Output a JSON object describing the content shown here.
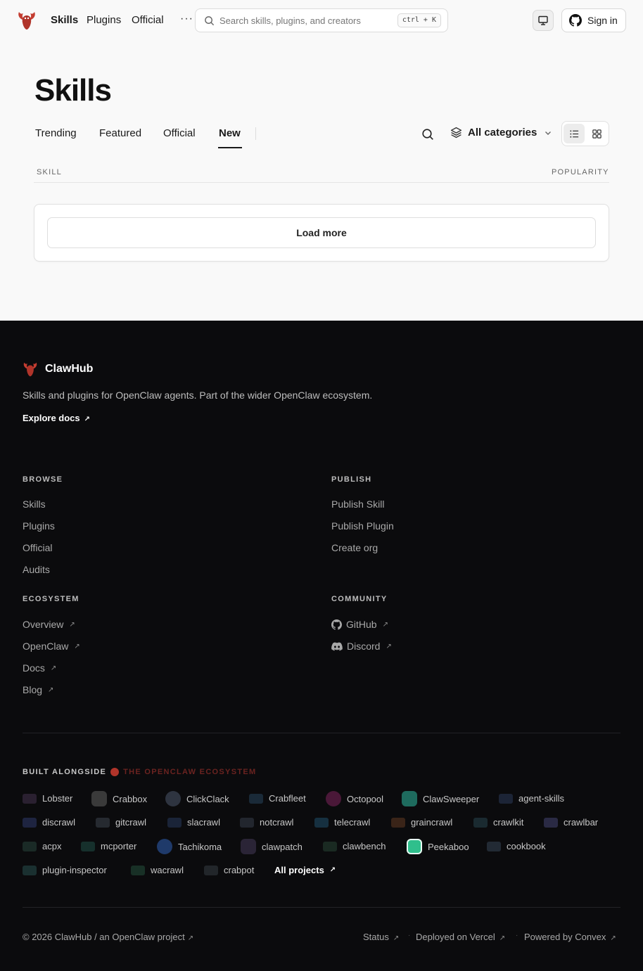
{
  "header": {
    "nav": [
      {
        "label": "Skills"
      },
      {
        "label": "Plugins"
      },
      {
        "label": "Official"
      }
    ],
    "more_label": "···",
    "search_placeholder": "Search skills, plugins, and creators",
    "shortcut": "ctrl + K",
    "sign_in_label": "Sign in"
  },
  "main": {
    "title": "Skills",
    "tabs": [
      {
        "label": "Trending"
      },
      {
        "label": "Featured"
      },
      {
        "label": "Official"
      },
      {
        "label": "New"
      }
    ],
    "active_tab": "New",
    "categories_label": "All categories",
    "columns": {
      "skill": "SKILL",
      "popularity": "POPULARITY"
    },
    "load_more_label": "Load more"
  },
  "footer": {
    "brand": "ClawHub",
    "tagline": "Skills and plugins for OpenClaw agents. Part of the wider OpenClaw ecosystem.",
    "explore_docs": "Explore docs",
    "browse": {
      "title": "BROWSE",
      "links": [
        "Skills",
        "Plugins",
        "Official",
        "Audits"
      ]
    },
    "publish": {
      "title": "PUBLISH",
      "links": [
        "Publish Skill",
        "Publish Plugin",
        "Create org"
      ]
    },
    "ecosystem": {
      "title": "ECOSYSTEM",
      "links": [
        "Overview",
        "OpenClaw",
        "Docs",
        "Blog"
      ]
    },
    "community": {
      "title": "COMMUNITY",
      "links": [
        "GitHub",
        "Discord"
      ]
    },
    "built_alongside": "BUILT ALONGSIDE",
    "ecosystem_name": "THE OPENCLAW ECOSYSTEM",
    "projects": [
      [
        "Lobster",
        "Crabbox",
        "ClickClack",
        "Crabfleet",
        "Octopool",
        "ClawSweeper",
        "agent-skills"
      ],
      [
        "discrawl",
        "gitcrawl",
        "slacrawl",
        "notcrawl",
        "telecrawl",
        "graincrawl",
        "crawlkit",
        "crawlbar"
      ],
      [
        "acpx",
        "mcporter",
        "Tachikoma",
        "clawpatch",
        "clawbench",
        "Peekaboo",
        "cookbook"
      ],
      [
        "plugin-inspector",
        "wacrawl",
        "crabpot"
      ]
    ],
    "all_projects": "All projects",
    "copyright": "© 2026 ClawHub / an OpenClaw project",
    "bottom_links": [
      "Status",
      "Deployed on Vercel",
      "Powered by Convex"
    ],
    "colors": {
      "background": "#0b0b0d",
      "accent": "#b0342a"
    }
  }
}
